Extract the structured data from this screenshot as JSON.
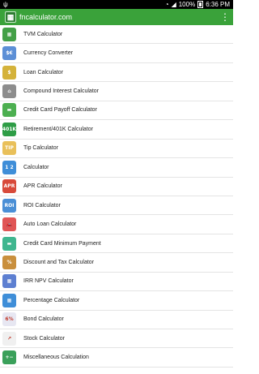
{
  "status_bar": {
    "time": "6:36 PM",
    "battery": "100%"
  },
  "app_bar": {
    "title": "fncalculator.com",
    "logo_glyph": "▦"
  },
  "list_items": [
    {
      "label": "TVM Calculator",
      "icon": "calculator-icon",
      "glyph": "▦",
      "color": "#43a047"
    },
    {
      "label": "Currency Converter",
      "icon": "currency-icon",
      "glyph": "$€",
      "color": "#5c8fd6"
    },
    {
      "label": "Loan Calculator",
      "icon": "loan-icon",
      "glyph": "$",
      "color": "#d4b23a"
    },
    {
      "label": "Compound Interest Calculator",
      "icon": "bank-icon",
      "glyph": "⌂",
      "color": "#8d8d8d"
    },
    {
      "label": "Credit Card Payoff Calculator",
      "icon": "credit-card-icon",
      "glyph": "▬",
      "color": "#4caf50"
    },
    {
      "label": "Retirement/401K Calculator",
      "icon": "retirement-icon",
      "glyph": "401K",
      "color": "#2e9d46"
    },
    {
      "label": "Tip Calculator",
      "icon": "tip-icon",
      "glyph": "TIP",
      "color": "#e9c05a"
    },
    {
      "label": "Calculator",
      "icon": "keypad-icon",
      "glyph": "1 2",
      "color": "#3f8ed8"
    },
    {
      "label": "APR Calculator",
      "icon": "apr-icon",
      "glyph": "APR",
      "color": "#d84a3a"
    },
    {
      "label": "ROI Calculator",
      "icon": "roi-icon",
      "glyph": "ROI",
      "color": "#4a8fd6"
    },
    {
      "label": "Auto Loan Calculator",
      "icon": "car-icon",
      "glyph": "🚗",
      "color": "#e05555"
    },
    {
      "label": "Credit Card Minimum Payment",
      "icon": "card-payment-icon",
      "glyph": "▬",
      "color": "#3fb68f"
    },
    {
      "label": "Discount and Tax Calculator",
      "icon": "discount-icon",
      "glyph": "%",
      "color": "#c98f3d"
    },
    {
      "label": "IRR NPV Calculator",
      "icon": "irr-icon",
      "glyph": "▦",
      "color": "#5d7fd1"
    },
    {
      "label": "Percentage Calculator",
      "icon": "percentage-icon",
      "glyph": "▦",
      "color": "#3f8ed8"
    },
    {
      "label": "Bond Calculator",
      "icon": "bond-icon",
      "glyph": "6%",
      "color": "#e7e7f2"
    },
    {
      "label": "Stock Calculator",
      "icon": "stock-icon",
      "glyph": "↗",
      "color": "#f0f0f0"
    },
    {
      "label": "Miscellaneous Calculation",
      "icon": "misc-icon",
      "glyph": "+−",
      "color": "#3aa05a"
    }
  ]
}
